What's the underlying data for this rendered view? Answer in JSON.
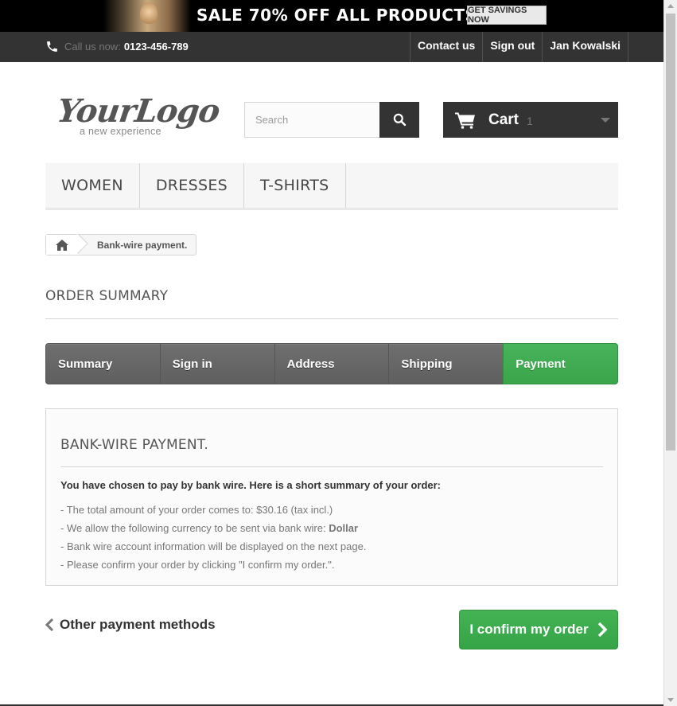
{
  "promo": {
    "headline": "SALE 70% OFF ALL PRODUCTS",
    "cta": "GET SAVINGS NOW"
  },
  "topbar": {
    "call_label": "Call us now:",
    "phone": "0123-456-789",
    "links": [
      "Contact us",
      "Sign out",
      "Jan Kowalski"
    ]
  },
  "header": {
    "logo_text": "YourLogo",
    "logo_tagline": "a new experience",
    "search_placeholder": "Search",
    "cart_label": "Cart",
    "cart_quantity": "1"
  },
  "menu": [
    "WOMEN",
    "DRESSES",
    "T-SHIRTS"
  ],
  "breadcrumb": {
    "current": "Bank-wire payment."
  },
  "page_heading": "ORDER SUMMARY",
  "steps": {
    "items": [
      "Summary",
      "Sign in",
      "Address",
      "Shipping",
      "Payment"
    ],
    "active": "Payment"
  },
  "bankwire": {
    "title": "BANK-WIRE PAYMENT.",
    "intro": "You have chosen to pay by bank wire. Here is a short summary of your order:",
    "line1": "- The total amount of your order comes to: $30.16 (tax incl.)",
    "line2_prefix": "- We allow the following currency to be sent via bank wire: ",
    "line2_currency": "Dollar",
    "line3": "- Bank wire account information will be displayed on the next page.",
    "line4": "- Please confirm your order by clicking \"I confirm my order.\"."
  },
  "actions": {
    "back_label": "Other payment methods",
    "confirm_label": "I confirm my order"
  },
  "colors": {
    "dark": "#333333",
    "green": "#3aa54b",
    "step_gray": "#666666"
  }
}
